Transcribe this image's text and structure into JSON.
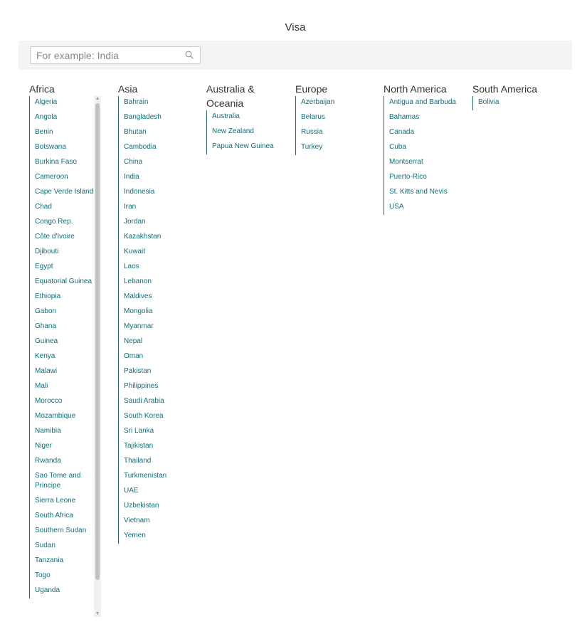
{
  "page": {
    "title": "Visa"
  },
  "search": {
    "placeholder": "For example: India",
    "value": ""
  },
  "regions": [
    {
      "name": "Africa",
      "countries": [
        "Algeria",
        "Angola",
        "Benin",
        "Botswana",
        "Burkina Faso",
        "Cameroon",
        "Cape Verde Islands",
        "Chad",
        "Congo Rep.",
        "Côte d'Ivoire",
        "Djibouti",
        "Egypt",
        "Equatorial Guinea",
        "Ethiopia",
        "Gabon",
        "Ghana",
        "Guinea",
        "Kenya",
        "Malawi",
        "Mali",
        "Morocco",
        "Mozambique",
        "Namibia",
        "Niger",
        "Rwanda",
        "Sao Tome and Principe",
        "Sierra Leone",
        "South Africa",
        "Southern Sudan",
        "Sudan",
        "Tanzania",
        "Togo",
        "Uganda"
      ]
    },
    {
      "name": "Asia",
      "countries": [
        "Bahrain",
        "Bangladesh",
        "Bhutan",
        "Cambodia",
        "China",
        "India",
        "Indonesia",
        "Iran",
        "Jordan",
        "Kazakhstan",
        "Kuwait",
        "Laos",
        "Lebanon",
        "Maldives",
        "Mongolia",
        "Myanmar",
        "Nepal",
        "Oman",
        "Pakistan",
        "Philippines",
        "Saudi Arabia",
        "South Korea",
        "Sri Lanka",
        "Tajikistan",
        "Thailand",
        "Turkmenistan",
        "UAE",
        "Uzbekistan",
        "Vietnam",
        "Yemen"
      ]
    },
    {
      "name": "Australia & Oceania",
      "countries": [
        "Australia",
        "New Zealand",
        "Papua New Guinea"
      ]
    },
    {
      "name": "Europe",
      "countries": [
        "Azerbaijan",
        "Belarus",
        "Russia",
        "Turkey"
      ]
    },
    {
      "name": "North America",
      "countries": [
        "Antigua and Barbuda",
        "Bahamas",
        "Canada",
        "Cuba",
        "Montserrat",
        "Puerto-Rico",
        "St. Kitts and Nevis",
        "USA"
      ]
    },
    {
      "name": "South America",
      "countries": [
        "Bolivia"
      ]
    }
  ],
  "colors": {
    "link": "#0e6e7a",
    "divider": "#2a6b75",
    "search_bg": "#f4f4f4"
  }
}
